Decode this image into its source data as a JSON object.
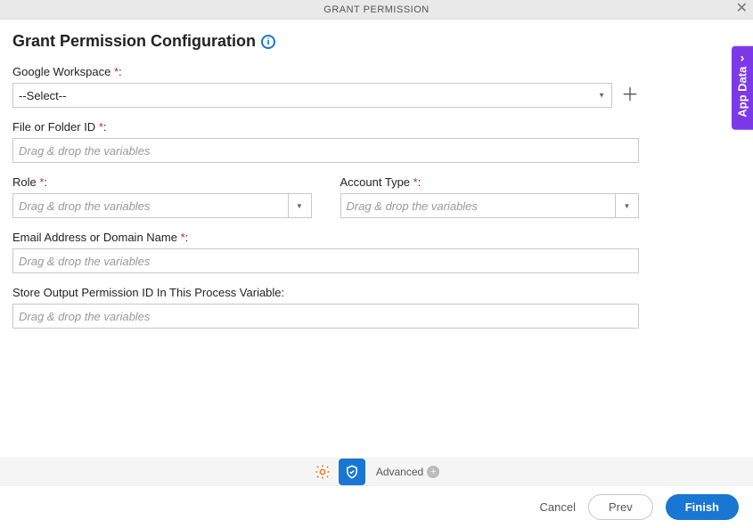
{
  "dialog": {
    "title": "GRANT PERMISSION"
  },
  "side_tab": {
    "label": "App Data"
  },
  "heading": "Grant Permission Configuration",
  "fields": {
    "gws": {
      "label": "Google Workspace ",
      "value": "--Select--"
    },
    "file_id": {
      "label": "File or Folder ID ",
      "placeholder": "Drag & drop the variables"
    },
    "role": {
      "label": "Role ",
      "placeholder": "Drag & drop the variables"
    },
    "account_type": {
      "label": "Account Type ",
      "placeholder": "Drag & drop the variables"
    },
    "email": {
      "label": "Email Address or Domain Name ",
      "placeholder": "Drag & drop the variables"
    },
    "store": {
      "label": "Store Output Permission ID In This Process Variable:",
      "placeholder": "Drag & drop the variables"
    }
  },
  "toolbar": {
    "advanced": "Advanced"
  },
  "footer": {
    "cancel": "Cancel",
    "prev": "Prev",
    "finish": "Finish"
  },
  "req_marker": "*",
  "colon": ":"
}
